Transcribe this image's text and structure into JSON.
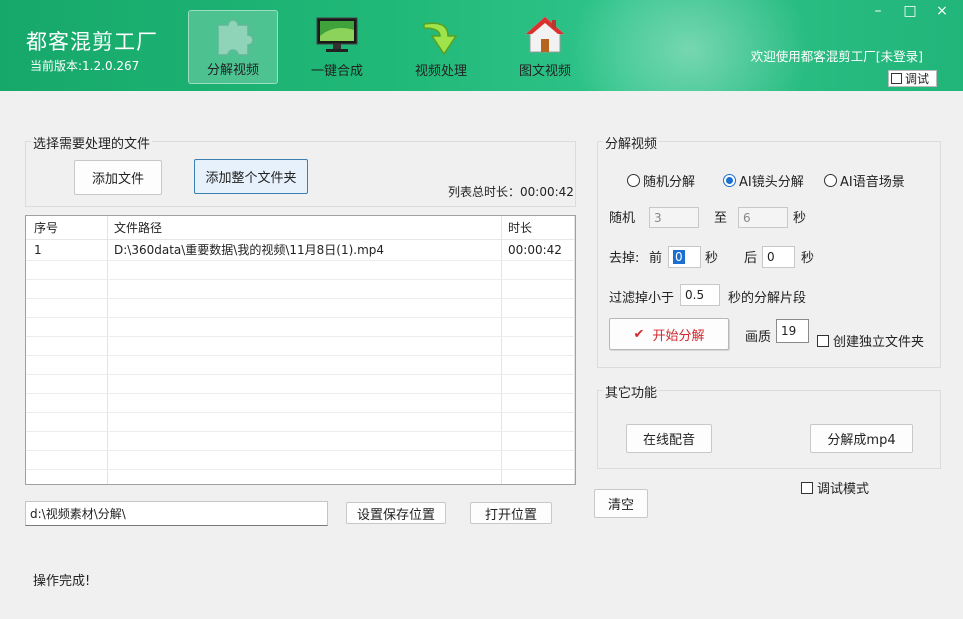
{
  "header": {
    "app_title": "都客混剪工厂",
    "version": "当前版本:1.2.0.267",
    "tabs": [
      {
        "label": "分解视频",
        "icon": "puzzle-icon",
        "active": true
      },
      {
        "label": "一键合成",
        "icon": "monitor-icon",
        "active": false
      },
      {
        "label": "视频处理",
        "icon": "green-arrow-icon",
        "active": false
      },
      {
        "label": "图文视频",
        "icon": "house-icon",
        "active": false
      }
    ],
    "window_controls": {
      "minimize": "–",
      "maximize": "□",
      "close": "×"
    },
    "welcome": "欢迎使用都客混剪工厂[未登录]",
    "debug_label": "调试"
  },
  "file_section": {
    "title": "选择需要处理的文件",
    "add_file": "添加文件",
    "add_folder": "添加整个文件夹",
    "total_duration": "列表总时长：00:00:42"
  },
  "table": {
    "columns": [
      "序号",
      "文件路径",
      "时长"
    ],
    "rows": [
      [
        "1",
        "D:\\360data\\重要数据\\我的视频\\11月8日(1).mp4",
        "00:00:42"
      ]
    ]
  },
  "output": {
    "path": "d:\\视频素材\\分解\\",
    "set_save": "设置保存位置",
    "open_location": "打开位置"
  },
  "status": "操作完成!",
  "split_section": {
    "title": "分解视频",
    "modes": [
      "随机分解",
      "AI镜头分解",
      "AI语音场景"
    ],
    "selected_mode": "AI镜头分解",
    "random_label": "随机",
    "random_from": "3",
    "to_label": "至",
    "random_to": "6",
    "sec_label": "秒",
    "trim_label": "去掉:",
    "front_label": "前",
    "front_value": "0",
    "back_label": "后",
    "back_value": "0",
    "filter_label": "过滤掉小于",
    "filter_value": "0.5",
    "filter_suffix": "秒的分解片段",
    "start_button": "开始分解",
    "quality_label": "画质",
    "quality_value": "19",
    "create_folder": "创建独立文件夹"
  },
  "other_section": {
    "title": "其它功能",
    "online_dub": "在线配音",
    "split_mp4": "分解成mp4"
  },
  "debug_mode": "调试模式",
  "clear_button": "清空",
  "colors": {
    "header_green": "#20b878",
    "status_green": "#1f8a30",
    "start_red": "#d0282e"
  }
}
